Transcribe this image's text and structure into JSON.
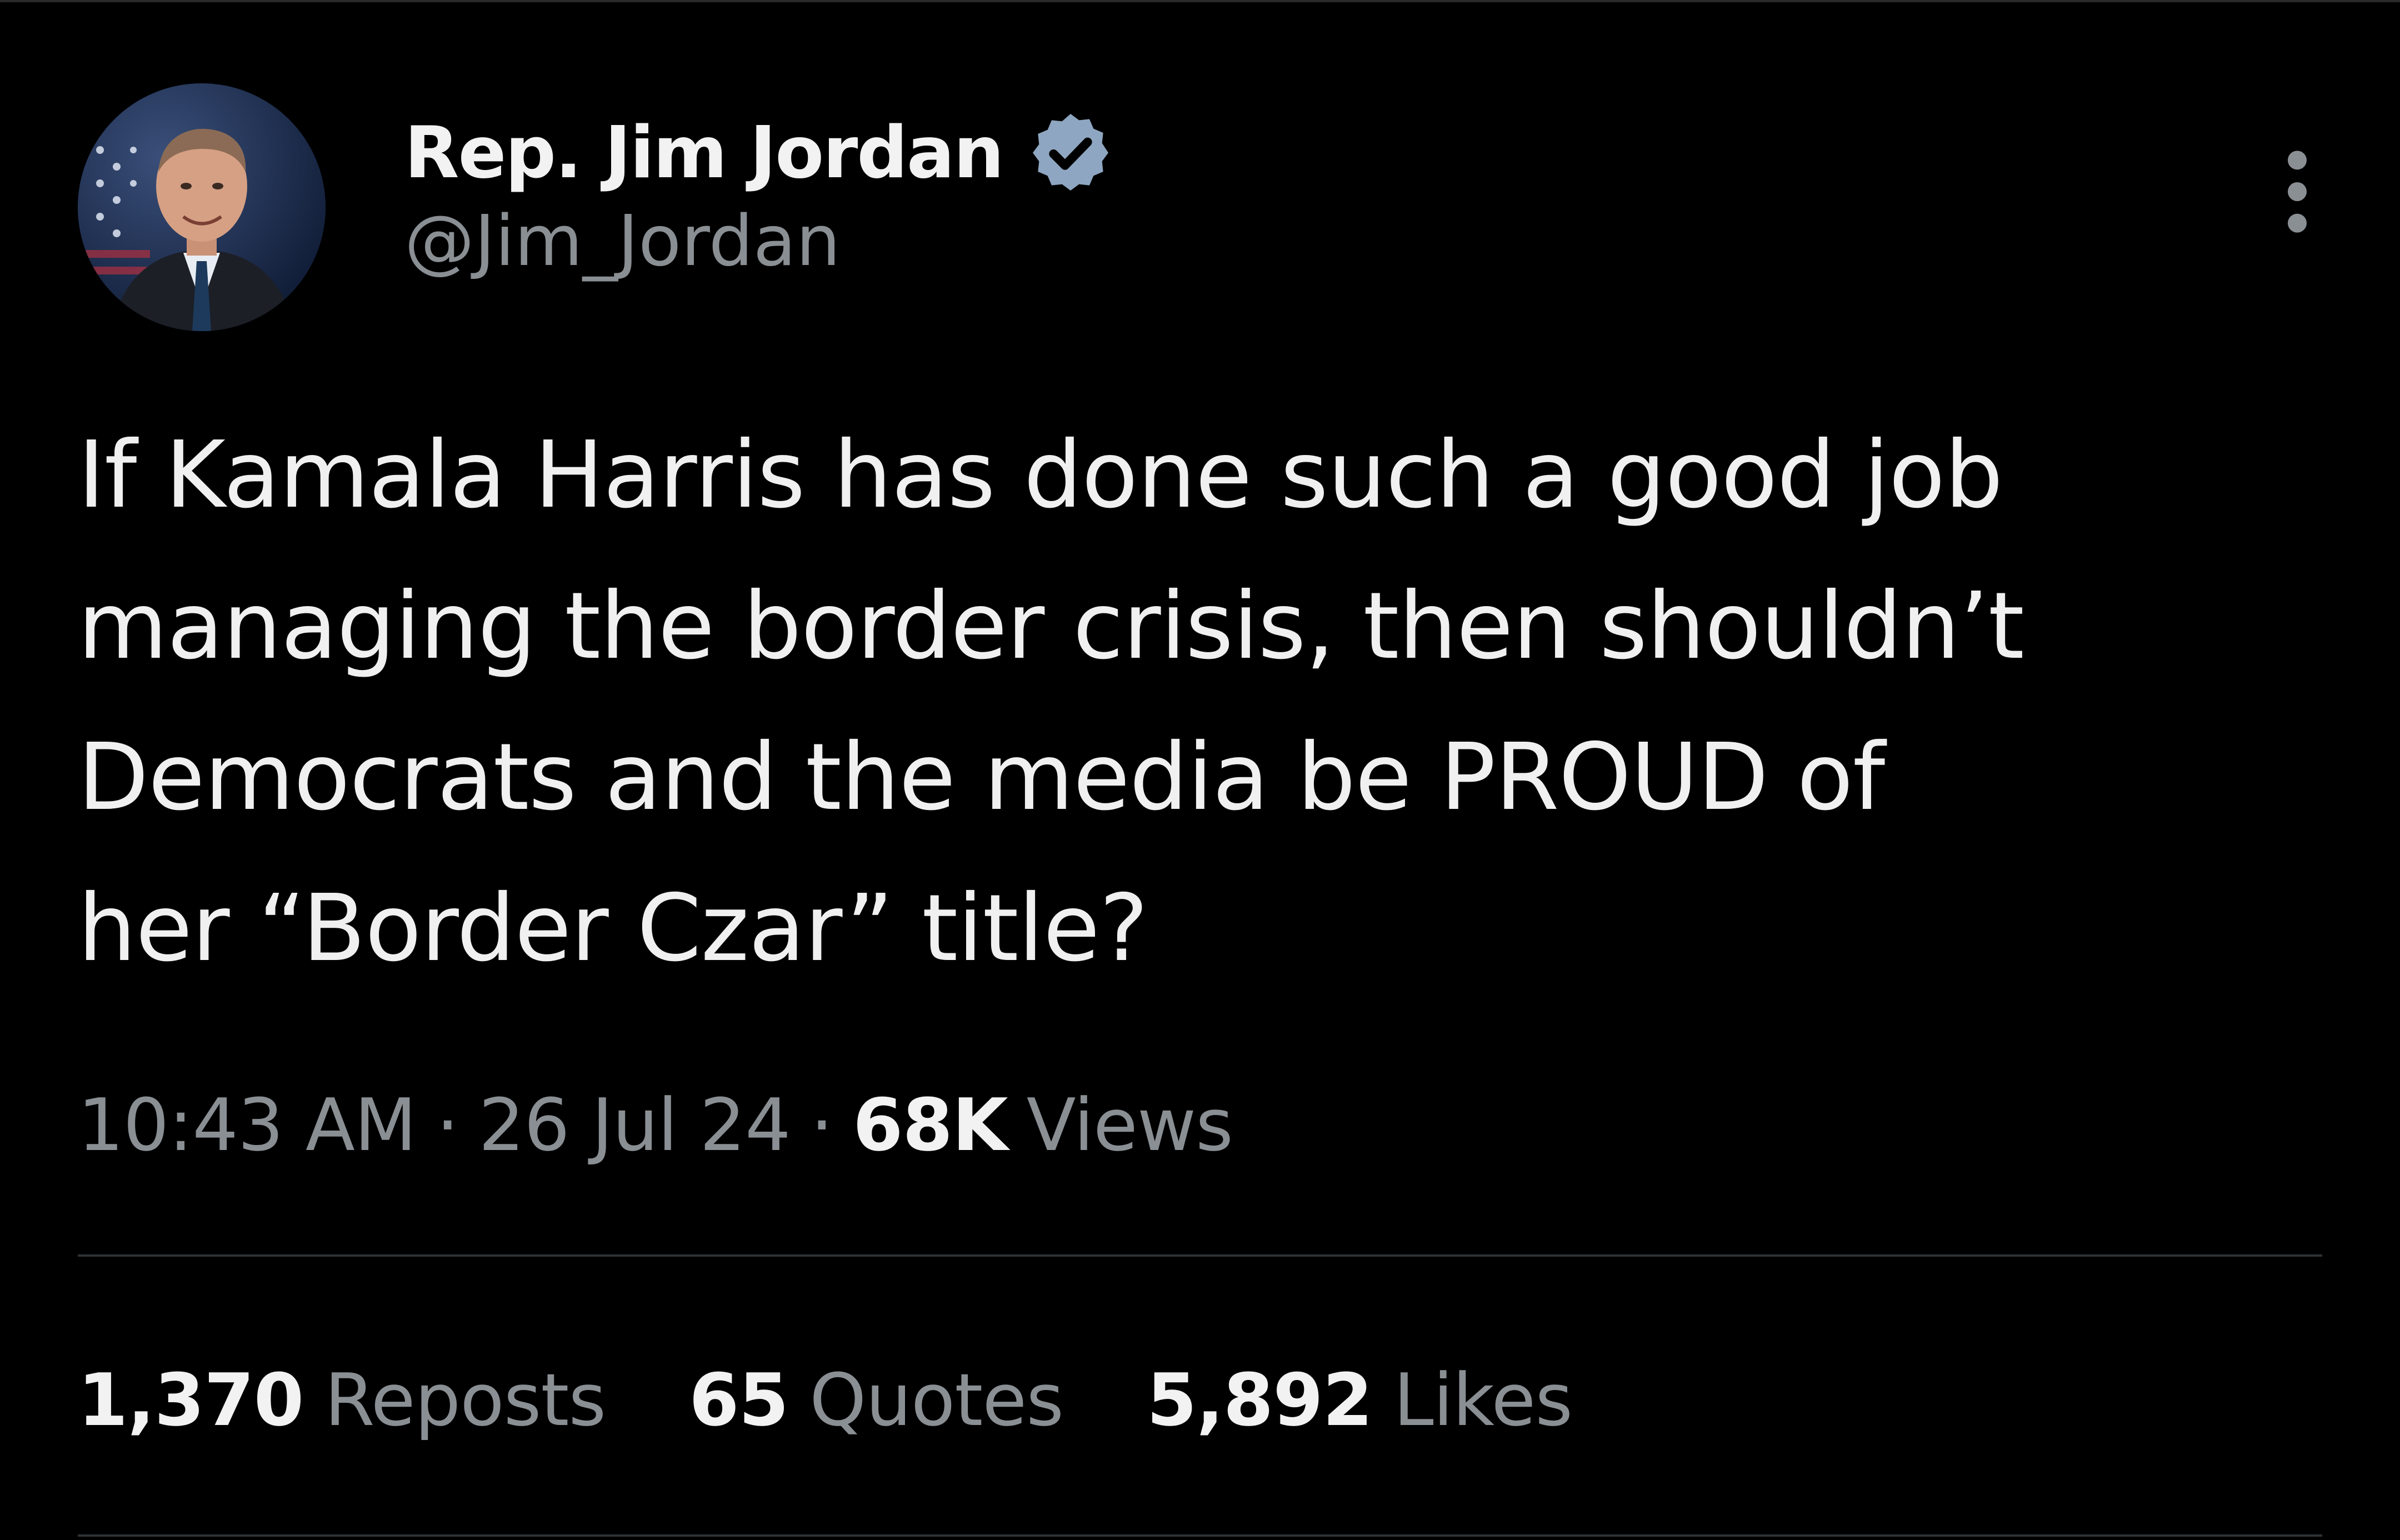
{
  "tweet": {
    "author": {
      "display_name": "Rep. Jim Jordan",
      "handle": "@Jim_Jordan",
      "verified": true,
      "avatar_icon": "profile-photo",
      "badge_color": "#8ea6c1"
    },
    "text": "If Kamala Harris has done such a good job\nmanaging the border crisis, then shouldn’t\nDemocrats and the media be PROUD of\nher “Border Czar” title?",
    "time": "10:43 AM",
    "separator": "·",
    "date": "26 Jul 24",
    "views_count": "68K",
    "views_label": "Views",
    "stats": [
      {
        "count": "1,370",
        "label": "Reposts"
      },
      {
        "count": "65",
        "label": "Quotes"
      },
      {
        "count": "5,892",
        "label": "Likes"
      }
    ]
  },
  "colors": {
    "background": "#000000",
    "primary_text": "#f2f2f2",
    "secondary_text": "#8a8f94",
    "divider": "#2f3336"
  }
}
